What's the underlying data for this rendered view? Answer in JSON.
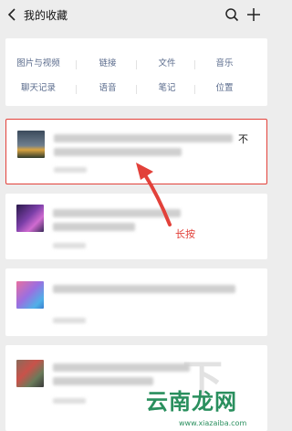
{
  "header": {
    "title": "我的收藏",
    "back_icon": "chevron-left-icon",
    "search_icon": "search-icon",
    "add_icon": "plus-icon"
  },
  "categories": {
    "row1": [
      "图片与视频",
      "链接",
      "文件",
      "音乐"
    ],
    "row2": [
      "聊天记录",
      "语音",
      "笔记",
      "位置"
    ]
  },
  "favorites": {
    "first_item_trailing_text": "不"
  },
  "annotation": {
    "label": "长按",
    "color": "#e2413a"
  },
  "watermark": {
    "big_text": "云南龙网",
    "small_text": "www.xiazaiba.com"
  }
}
